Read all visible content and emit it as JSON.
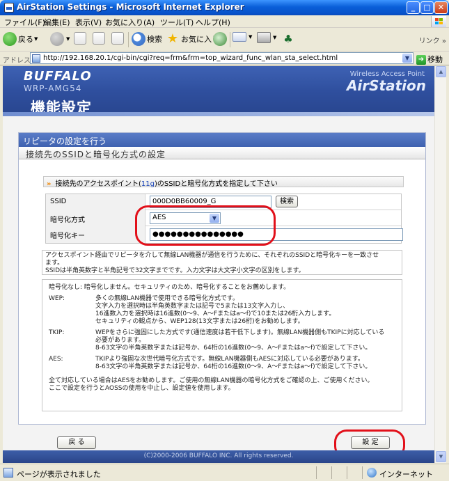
{
  "window": {
    "title": "AirStation Settings - Microsoft Internet Explorer",
    "minimize": "_",
    "maximize": "□",
    "close": "✕"
  },
  "menu": {
    "items": [
      "ファイル(F)",
      "編集(E)",
      "表示(V)",
      "お気に入り(A)",
      "ツール(T)",
      "ヘルプ(H)"
    ]
  },
  "toolbar": {
    "back": "戻る",
    "search": "検索",
    "favorites": "お気に入り",
    "link": "リンク",
    "more": "»"
  },
  "address": {
    "label": "アドレス(D)",
    "url": "http://192.168.20.1/cgi-bin/cgi?req=frm&frm=top_wizard_func_wlan_sta_select.html",
    "go": "移動"
  },
  "header": {
    "brand": "BUFFALO",
    "model": "WRP-AMG54",
    "wap": "Wireless Access Point",
    "product": "AirStation",
    "title": "機能設定"
  },
  "section": {
    "title": "リピータの設定を行う",
    "subtitle": "接続先のSSIDと暗号化方式の設定"
  },
  "notice": {
    "prefix": "接続先のアクセスポイント(",
    "highlight": "11g",
    "suffix": ")のSSIDと暗号化方式を指定して下さい"
  },
  "form": {
    "ssid_label": "SSID",
    "ssid_value": "000D0BB60009_G",
    "search_button": "検索",
    "encryption_label": "暗号化方式",
    "encryption_value": "AES",
    "key_label": "暗号化キー",
    "key_value": "●●●●●●●●●●●●●●●"
  },
  "description": {
    "lines": [
      "アクセスポイント経由でリピータを介して無線LAN機器が通信を行うために、それぞれのSSIDと暗号化キーを一致させ",
      "ます。",
      "SSIDは半角英数字と半角記号で32文字までです。入力文字は大文字小文字の区別をします。"
    ]
  },
  "help": {
    "none_text": "暗号化なし: 暗号化しません。セキュリティのため、暗号化することをお薦めします。",
    "wep_label": "WEP:",
    "wep_lines": [
      "多くの無線LAN機器で使用できる暗号化方式です。",
      "文字入力を選択時は半角英数字または記号で5または13文字入力し、",
      "16進数入力を選択時は16進数(0〜9、A〜Fまたはa〜f)で10または26桁入力します。",
      "セキュリティの観点から、WEP128(13文字または26桁)をお勧めします。"
    ],
    "tkip_label": "TKIP:",
    "tkip_lines": [
      "WEPをさらに強固にした方式です(通信速度は若干低下します)。無線LAN機器側もTKIPに対応している",
      "必要があります。",
      "8-63文字の半角英数字または記号か、64桁の16進数(0〜9、A〜Fまたはa〜f)で設定して下さい。"
    ],
    "aes_label": "AES:",
    "aes_lines": [
      "TKIPより強固な次世代暗号化方式です。無線LAN機器側もAESに対応している必要があります。",
      "8-63文字の半角英数字または記号か、64桁の16進数(0〜9、A〜Fまたはa〜f)で設定して下さい。"
    ],
    "footer_lines": [
      "全て対応している場合はAESをお勧めします。ご使用の無線LAN機器の暗号化方式をご確認の上、ご使用ください。",
      "ここで設定を行うとAOSSの使用を中止し、設定値を使用します。"
    ]
  },
  "buttons": {
    "back": "戻 る",
    "submit": "設 定"
  },
  "footer": {
    "copyright": "(C)2000-2006 BUFFALO INC. All rights reserved."
  },
  "status": {
    "text": "ページが表示されました",
    "zone": "インターネット"
  },
  "colors": {
    "banner": "#2f4f9e",
    "highlight_circle": "#e2101a",
    "accent_chevron": "#f08a0a"
  }
}
